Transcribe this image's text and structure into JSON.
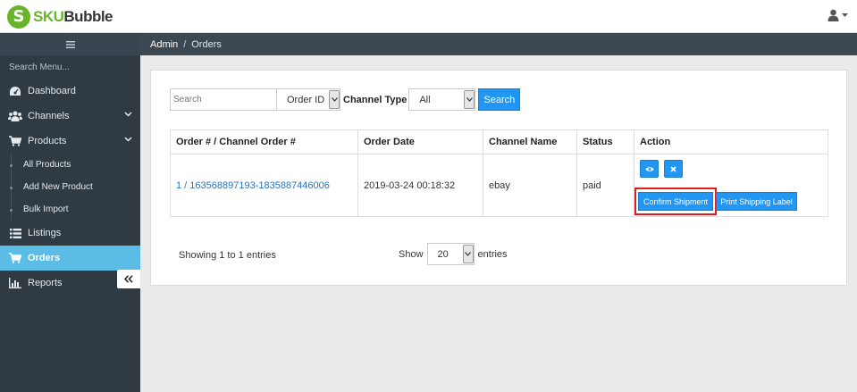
{
  "app": {
    "logo_sku": "SKU",
    "logo_bubble": "Bubble",
    "logo_badge": "S",
    "accent_color": "#6ab42d"
  },
  "header": {
    "user_icon": "user-icon",
    "caret_icon": "caret-down-icon"
  },
  "sidebar": {
    "toggle_icon": "hamburger-icon",
    "search_placeholder": "Search Menu...",
    "items": [
      {
        "label": "Dashboard",
        "icon": "dashboard-icon"
      },
      {
        "label": "Channels",
        "icon": "users-icon",
        "has_submenu": true
      },
      {
        "label": "Products",
        "icon": "cart-icon",
        "has_submenu": true,
        "expanded": true,
        "children": [
          "All Products",
          "Add New Product",
          "Bulk Import"
        ]
      },
      {
        "label": "Listings",
        "icon": "list-icon"
      },
      {
        "label": "Orders",
        "icon": "cart-icon",
        "active": true
      },
      {
        "label": "Reports",
        "icon": "bar-chart-icon",
        "has_submenu": true
      }
    ],
    "active_color": "#5bbde6",
    "collapse_icon": "double-chevron-left-icon"
  },
  "breadcrumb": {
    "root": "Admin",
    "separator": "/",
    "current": "Orders"
  },
  "filter": {
    "search_placeholder": "Search",
    "search_value": "",
    "field_select": "Order ID",
    "channel_type_label": "Channel Type",
    "channel_select": "All",
    "search_button": "Search"
  },
  "table": {
    "columns": [
      "Order # / Channel Order #",
      "Order Date",
      "Channel Name",
      "Status",
      "Action"
    ],
    "rows": [
      {
        "order": "1 / 163568897193-1835887446006",
        "date": "2019-03-24 00:18:32",
        "channel": "ebay",
        "status": "paid",
        "actions": {
          "view_icon": "eye-icon",
          "delete_icon": "close-icon",
          "confirm": "Confirm Shipment",
          "print": "Print Shipping Label"
        }
      }
    ]
  },
  "pagination": {
    "info": "Showing 1 to 1 entries",
    "show_label": "Show",
    "page_size": "20",
    "entries_label": "entries"
  }
}
